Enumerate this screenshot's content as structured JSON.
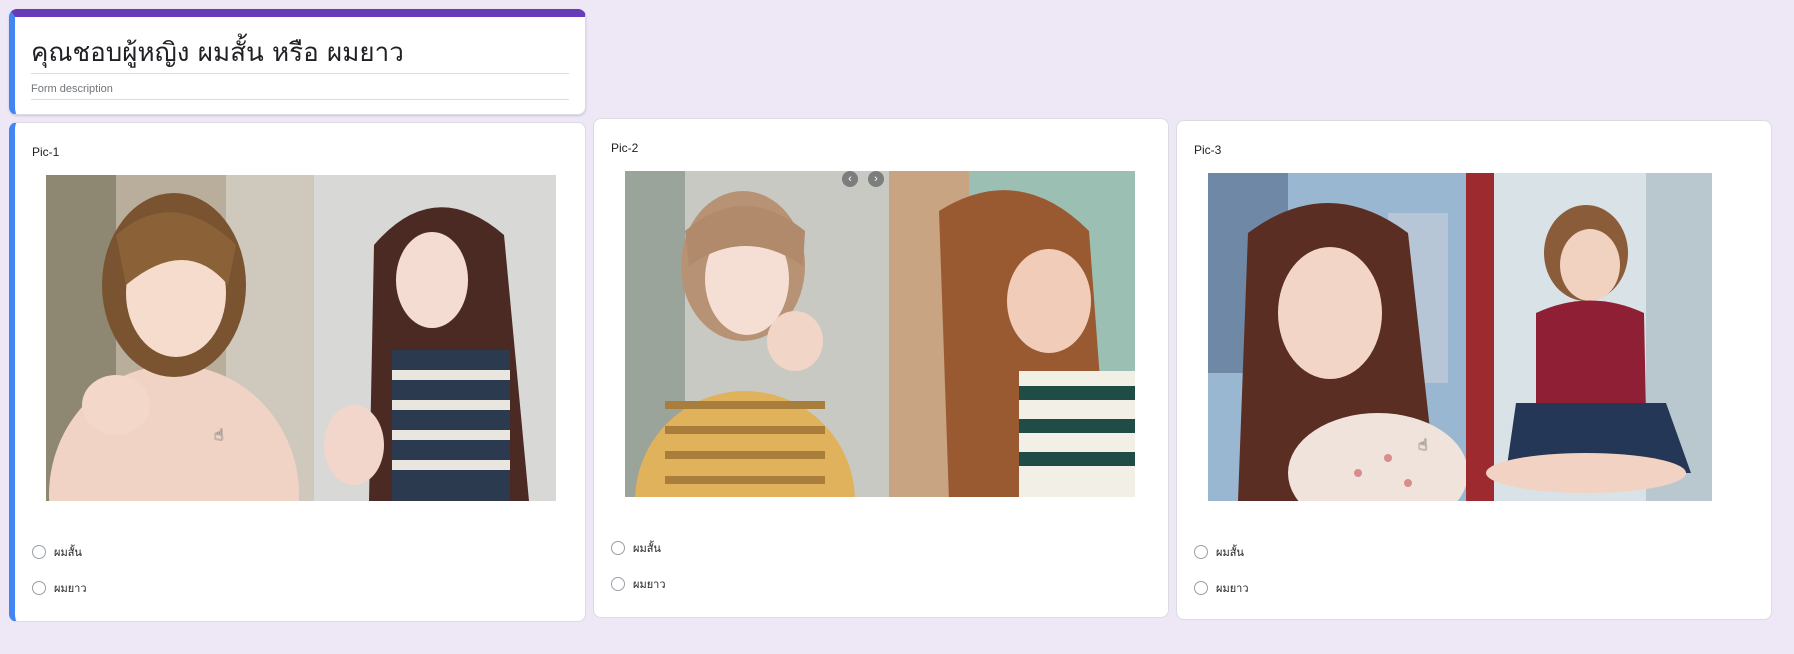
{
  "form": {
    "title": "คุณชอบผู้หญิง ผมสั้น หรือ ผมยาว",
    "description": "Form description"
  },
  "questions": [
    {
      "label": "Pic-1",
      "options": [
        "ผมสั้น",
        "ผมยาว"
      ],
      "photos": [
        "short-hair-woman-pink-top",
        "long-hair-woman-striped-top"
      ]
    },
    {
      "label": "Pic-2",
      "options": [
        "ผมสั้น",
        "ผมยาว"
      ],
      "photos": [
        "short-hair-woman-striped-sweater",
        "long-wavy-hair-woman-striped-shirt"
      ],
      "image_controls": {
        "prev": "‹",
        "next": "›"
      }
    },
    {
      "label": "Pic-3",
      "options": [
        "ผมสั้น",
        "ผมยาว"
      ],
      "photos": [
        "long-hair-woman-selfie-city",
        "short-hair-woman-sitting-red-top"
      ]
    }
  ],
  "colors": {
    "background": "#ede7f6",
    "header_accent": "#673ab7",
    "active_accent": "#4285f4"
  }
}
